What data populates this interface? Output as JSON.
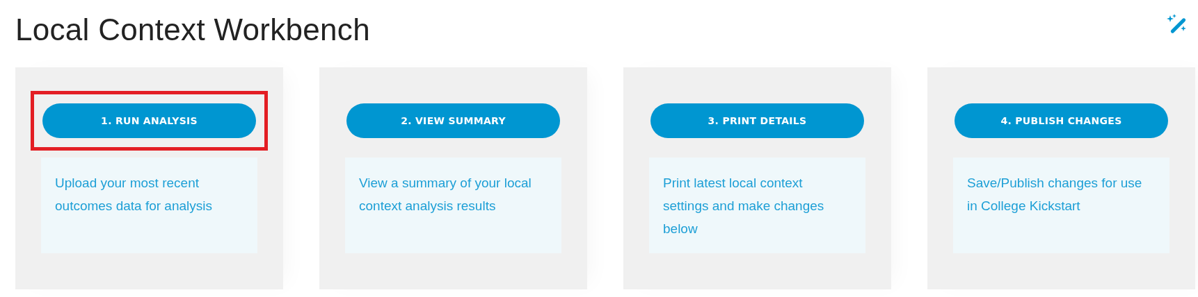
{
  "title": "Local Context Workbench",
  "steps": [
    {
      "button": "1. RUN ANALYSIS",
      "description": "Upload your most recent outcomes data for analysis",
      "highlighted": true
    },
    {
      "button": "2. VIEW SUMMARY",
      "description": "View a summary of your local context analysis results",
      "highlighted": false
    },
    {
      "button": "3. PRINT DETAILS",
      "description": "Print latest local context settings and make changes below",
      "highlighted": false
    },
    {
      "button": "4. PUBLISH CHANGES",
      "description": "Save/Publish changes for use in College Kickstart",
      "highlighted": false
    }
  ]
}
